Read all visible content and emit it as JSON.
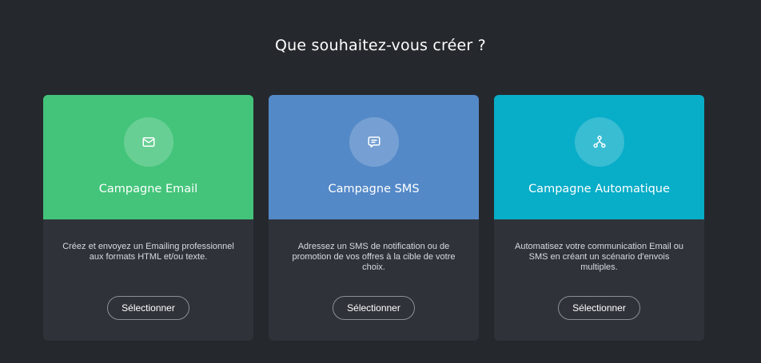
{
  "header": {
    "title": "Que souhaitez-vous créer ?"
  },
  "cards": [
    {
      "title": "Campagne Email",
      "icon": "envelope-icon",
      "color": "#43c47a",
      "description": "Créez et envoyez un Emailing professionnel aux formats HTML et/ou texte.",
      "button_label": "Sélectionner"
    },
    {
      "title": "Campagne SMS",
      "icon": "message-icon",
      "color": "#5489c8",
      "description": "Adressez un SMS de notification ou de promotion de vos offres à la cible de votre choix.",
      "button_label": "Sélectionner"
    },
    {
      "title": "Campagne Automatique",
      "icon": "workflow-icon",
      "color": "#08adc8",
      "description": "Automatisez votre communication Email ou SMS en créant un scénario d'envois multiples.",
      "button_label": "Sélectionner"
    }
  ],
  "colors": {
    "background": "#25282d",
    "card_body": "#2f3339",
    "text_primary": "#ffffff"
  }
}
